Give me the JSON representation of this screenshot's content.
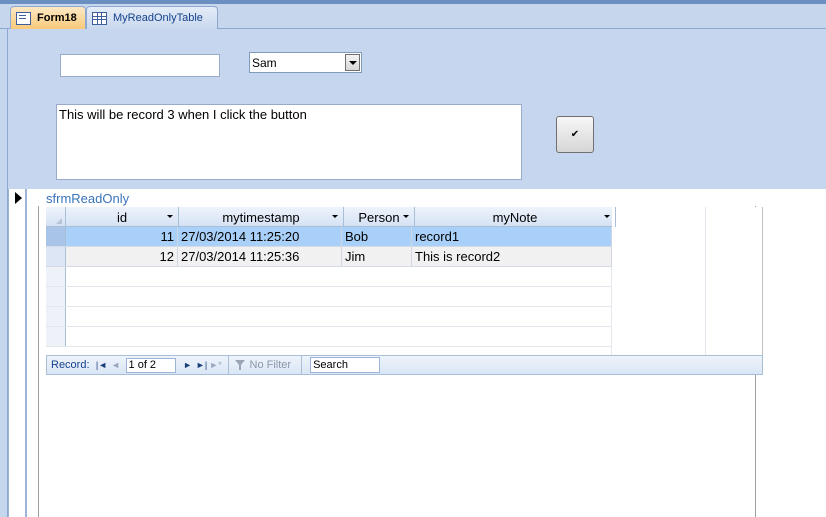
{
  "tabs": [
    {
      "label": "Form18",
      "icon": "form-icon",
      "active": true
    },
    {
      "label": "MyReadOnlyTable",
      "icon": "table-icon",
      "active": false
    }
  ],
  "header": {
    "textbox1_value": "",
    "combo_value": "Sam",
    "note_value": "This will be record 3 when I click the button",
    "button_glyph": "✔"
  },
  "subform": {
    "label": "sfrmReadOnly",
    "columns": [
      "id",
      "mytimestamp",
      "Person",
      "myNote"
    ],
    "rows": [
      {
        "id": "11",
        "mytimestamp": "27/03/2014 11:25:20",
        "Person": "Bob",
        "myNote": "record1"
      },
      {
        "id": "12",
        "mytimestamp": "27/03/2014 11:25:36",
        "Person": "Jim",
        "myNote": "This is record2"
      }
    ]
  },
  "navigation": {
    "record_label": "Record:",
    "position": "1 of 2",
    "first_glyph": "|◄",
    "prev_glyph": "◄",
    "next_glyph": "►",
    "last_glyph": "►|",
    "new_glyph": "►*",
    "no_filter_label": "No Filter",
    "search_value": "Search"
  },
  "colors": {
    "header_bg": "#c6d6ee",
    "selected_row": "#a9d0f8",
    "label_blue": "#3b73b9"
  }
}
